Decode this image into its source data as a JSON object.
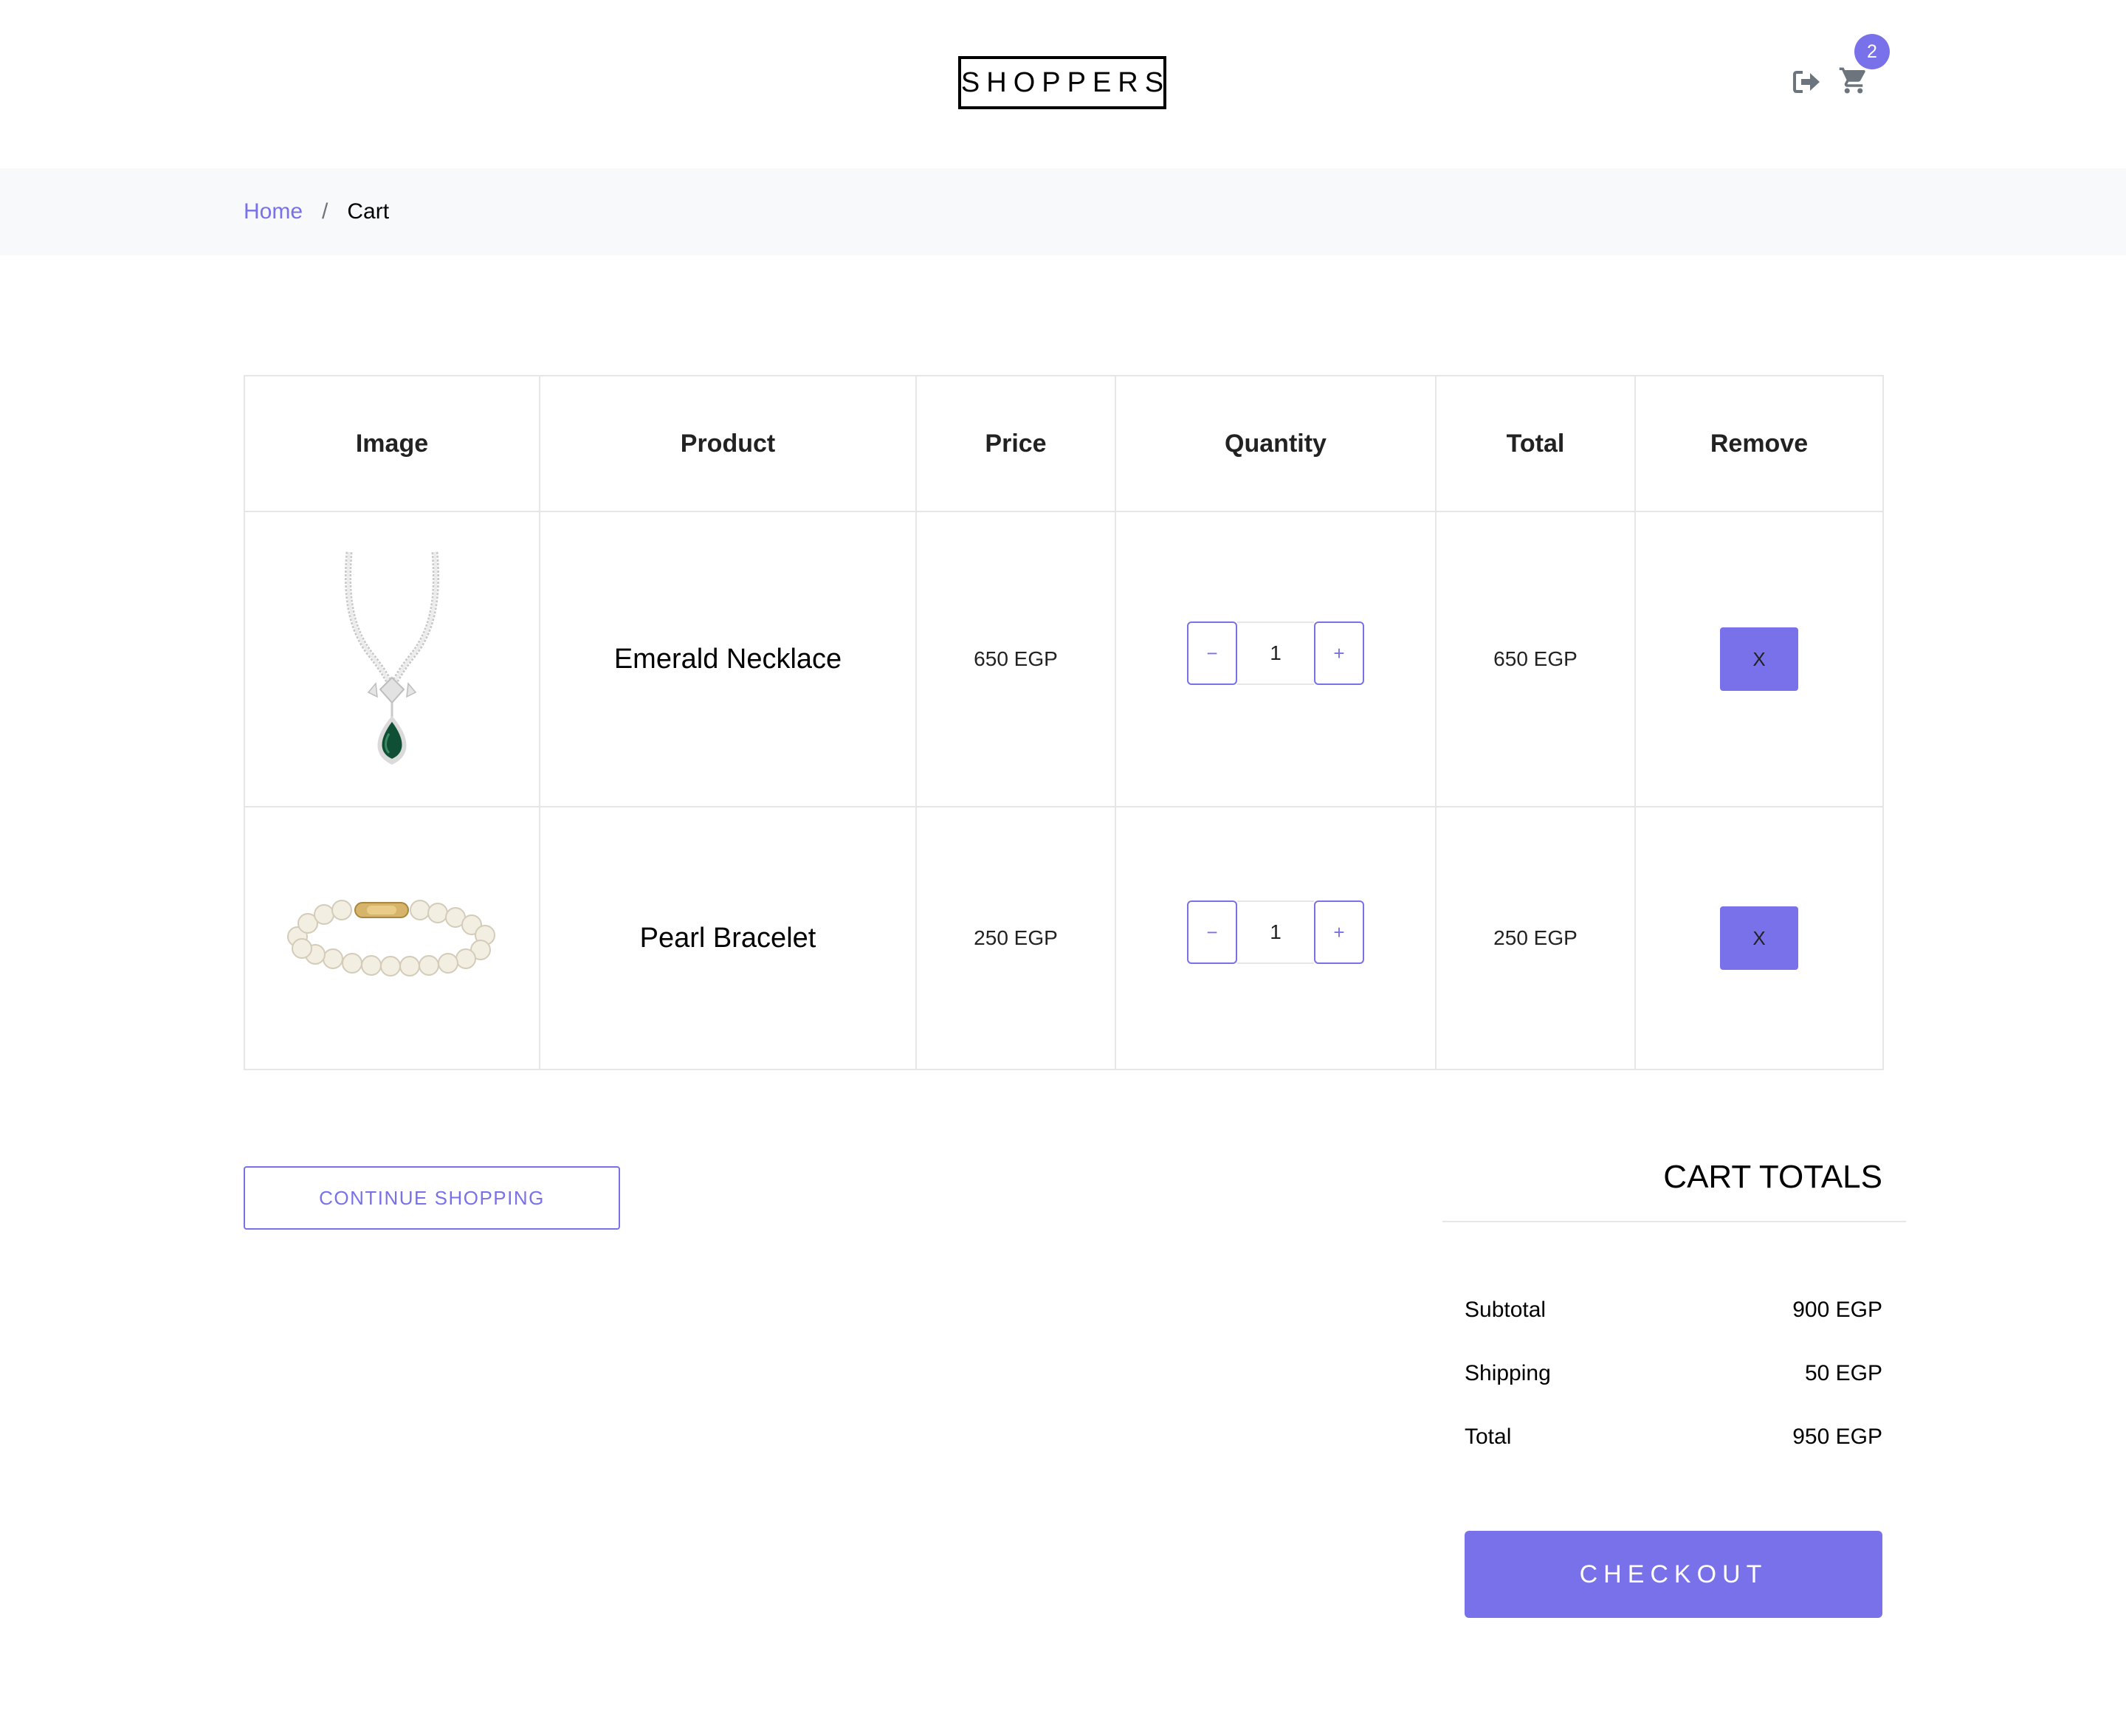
{
  "header": {
    "logo": "SHOPPERS",
    "cart_count": "2",
    "icons": [
      "sign-out-icon",
      "shopping-cart-icon"
    ]
  },
  "breadcrumb": {
    "home": "Home",
    "separator": "/",
    "current": "Cart"
  },
  "table": {
    "headers": [
      "Image",
      "Product",
      "Price",
      "Quantity",
      "Total",
      "Remove"
    ],
    "rows": [
      {
        "image": "emerald-necklace-image",
        "product": "Emerald Necklace",
        "price": "650 EGP",
        "quantity": "1",
        "minus": "−",
        "plus": "+",
        "total": "650 EGP",
        "remove": "X"
      },
      {
        "image": "pearl-bracelet-image",
        "product": "Pearl Bracelet",
        "price": "250 EGP",
        "quantity": "1",
        "minus": "−",
        "plus": "+",
        "total": "250 EGP",
        "remove": "X"
      }
    ]
  },
  "continue_shopping": "CONTINUE SHOPPING",
  "totals": {
    "title": "CART TOTALS",
    "subtotal_label": "Subtotal",
    "subtotal_value": "900 EGP",
    "shipping_label": "Shipping",
    "shipping_value": "50 EGP",
    "total_label": "Total",
    "total_value": "950 EGP",
    "checkout": "CHECKOUT"
  },
  "colors": {
    "accent": "#7971ea",
    "breadcrumb_bg": "#f8f9fa",
    "border": "#e6e6e6"
  }
}
